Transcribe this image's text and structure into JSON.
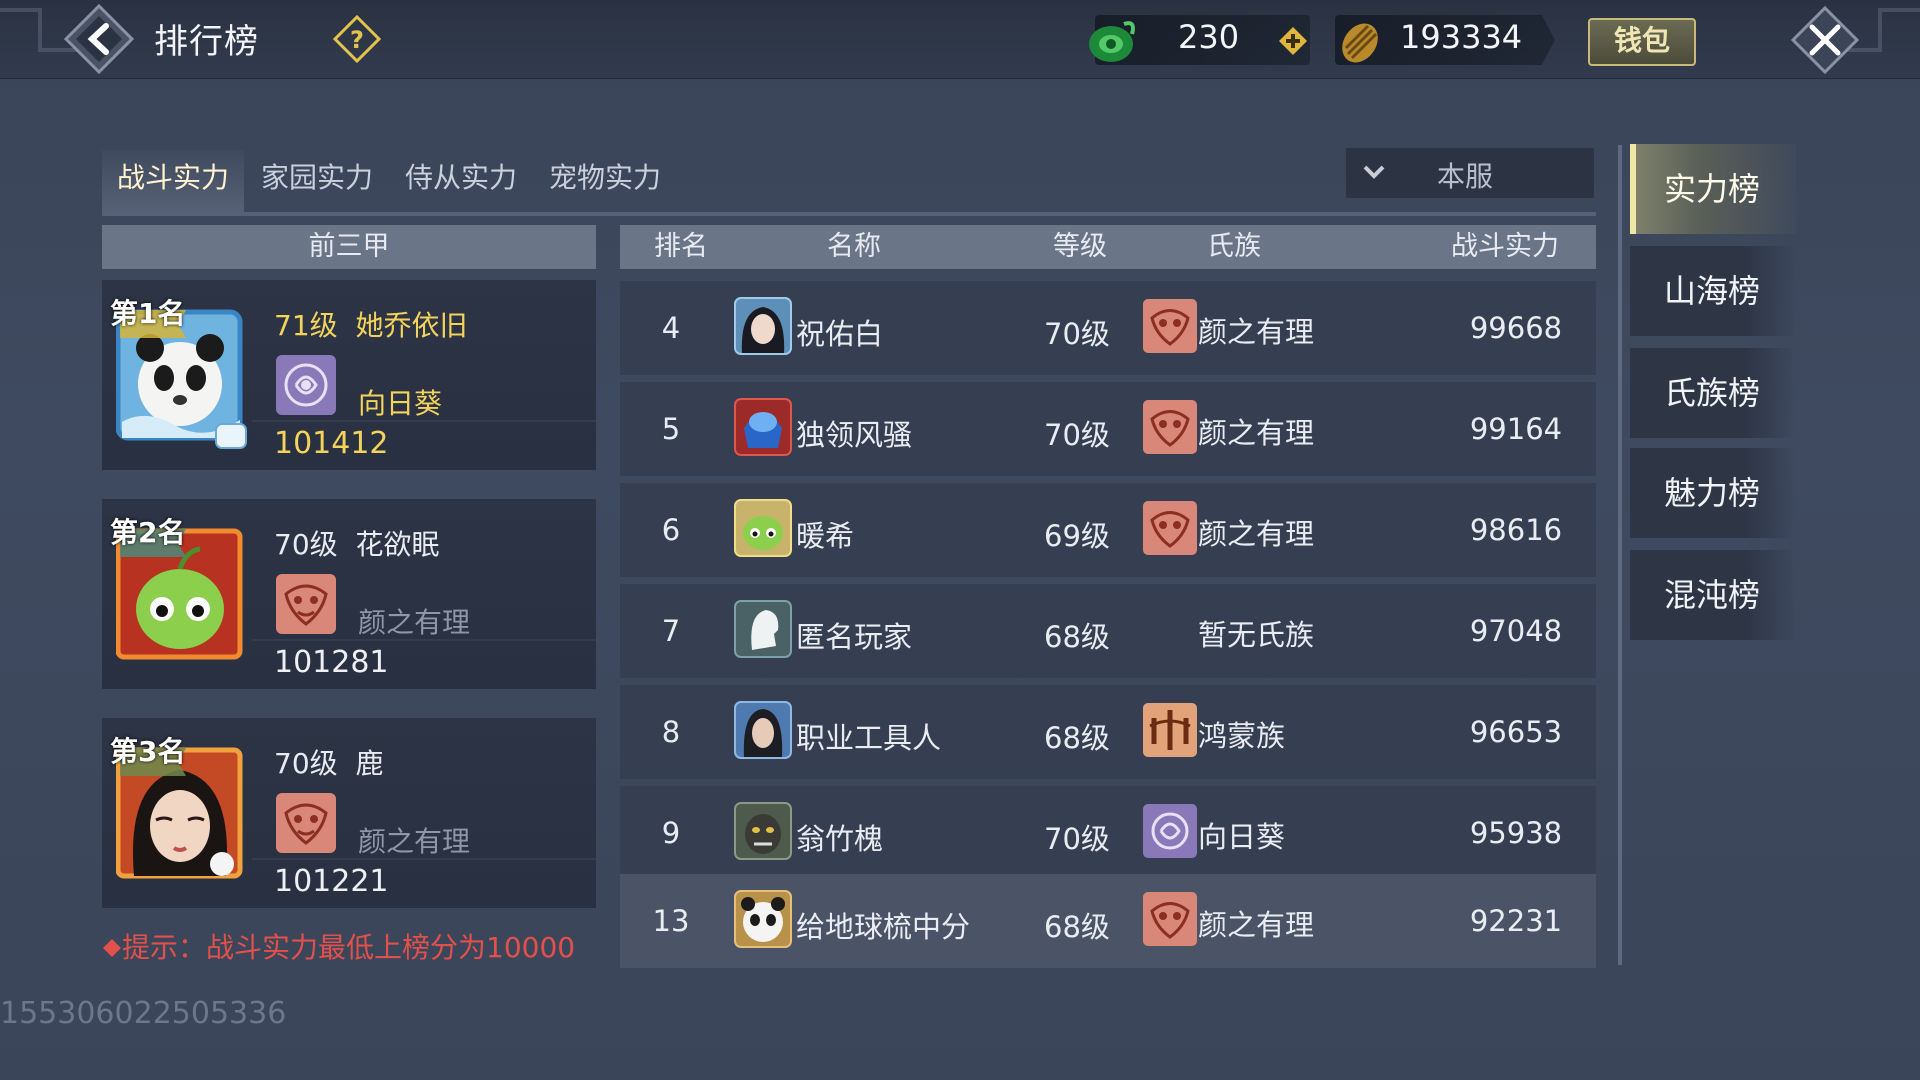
{
  "header": {
    "title": "排行榜",
    "jade": "230",
    "coin": "193334",
    "wallet_label": "钱包"
  },
  "tabs": [
    {
      "label": "战斗实力",
      "active": true
    },
    {
      "label": "家园实力",
      "active": false
    },
    {
      "label": "侍从实力",
      "active": false
    },
    {
      "label": "宠物实力",
      "active": false
    }
  ],
  "server_filter": "本服",
  "left": {
    "header": "前三甲",
    "top3": [
      {
        "rank_label": "第1名",
        "level": "71级",
        "name": "她乔依旧",
        "clan": "向日葵",
        "power": "101412"
      },
      {
        "rank_label": "第2名",
        "level": "70级",
        "name": "花欲眠",
        "clan": "颜之有理",
        "power": "101281"
      },
      {
        "rank_label": "第3名",
        "level": "70级",
        "name": "鹿",
        "clan": "颜之有理",
        "power": "101221"
      }
    ],
    "tip": "提示：战斗实力最低上榜分为10000"
  },
  "table": {
    "columns": [
      "排名",
      "名称",
      "等级",
      "氏族",
      "战斗实力"
    ],
    "rows": [
      {
        "rank": "4",
        "name": "祝佑白",
        "level": "70级",
        "clan": "颜之有理",
        "power": "99668"
      },
      {
        "rank": "5",
        "name": "独领风骚",
        "level": "70级",
        "clan": "颜之有理",
        "power": "99164"
      },
      {
        "rank": "6",
        "name": "暖希",
        "level": "69级",
        "clan": "颜之有理",
        "power": "98616"
      },
      {
        "rank": "7",
        "name": "匿名玩家",
        "level": "68级",
        "clan": "暂无氏族",
        "power": "97048"
      },
      {
        "rank": "8",
        "name": "职业工具人",
        "level": "68级",
        "clan": "鸿蒙族",
        "power": "96653"
      },
      {
        "rank": "9",
        "name": "翁竹槐",
        "level": "70级",
        "clan": "向日葵",
        "power": "95938"
      }
    ],
    "me": {
      "rank": "13",
      "name": "给地球梳中分",
      "level": "68级",
      "clan": "颜之有理",
      "power": "92231"
    }
  },
  "side_menu": [
    {
      "label": "实力榜",
      "active": true
    },
    {
      "label": "山海榜",
      "active": false
    },
    {
      "label": "氏族榜",
      "active": false
    },
    {
      "label": "魅力榜",
      "active": false
    },
    {
      "label": "混沌榜",
      "active": false
    }
  ],
  "uid": "155306022505336",
  "colors": {
    "gold": "#f4d35b",
    "tip_red": "#e2504b",
    "accent": "#d8cd95"
  }
}
